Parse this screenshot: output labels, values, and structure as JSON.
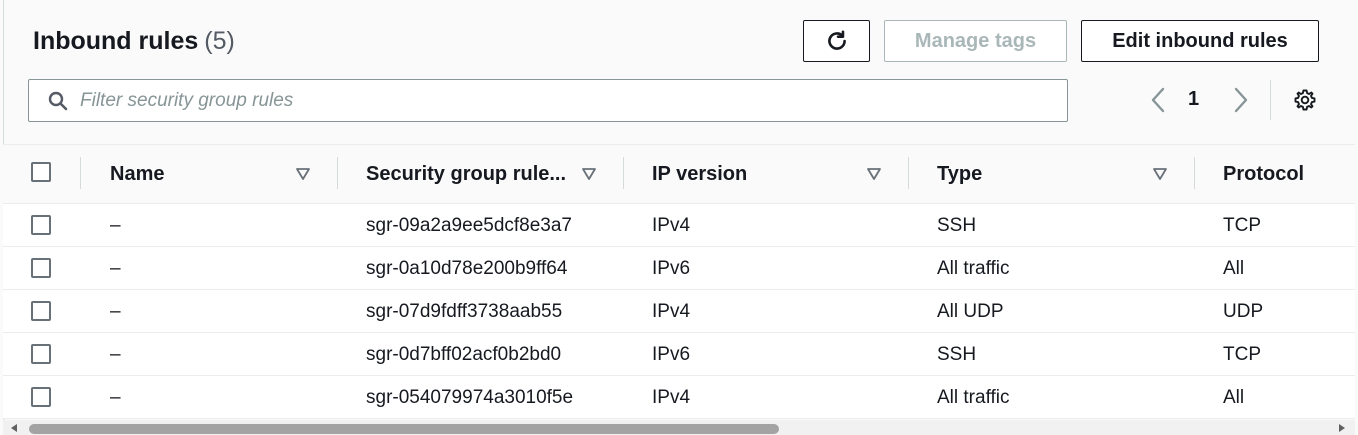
{
  "header": {
    "title": "Inbound rules",
    "count": "(5)",
    "manage_tags_label": "Manage tags",
    "edit_inbound_label": "Edit inbound rules"
  },
  "search": {
    "placeholder": "Filter security group rules",
    "value": ""
  },
  "pagination": {
    "current_page": "1"
  },
  "columns": [
    "Name",
    "Security group rule...",
    "IP version",
    "Type",
    "Protocol"
  ],
  "rows": [
    {
      "name": "–",
      "rule_id": "sgr-09a2a9ee5dcf8e3a7",
      "ip_version": "IPv4",
      "type": "SSH",
      "protocol": "TCP"
    },
    {
      "name": "–",
      "rule_id": "sgr-0a10d78e200b9ff64",
      "ip_version": "IPv6",
      "type": "All traffic",
      "protocol": "All"
    },
    {
      "name": "–",
      "rule_id": "sgr-07d9fdff3738aab55",
      "ip_version": "IPv4",
      "type": "All UDP",
      "protocol": "UDP"
    },
    {
      "name": "–",
      "rule_id": "sgr-0d7bff02acf0b2bd0",
      "ip_version": "IPv6",
      "type": "SSH",
      "protocol": "TCP"
    },
    {
      "name": "–",
      "rule_id": "sgr-054079974a3010f5e",
      "ip_version": "IPv4",
      "type": "All traffic",
      "protocol": "All"
    }
  ],
  "icons": {
    "refresh": "refresh-icon",
    "search": "search-icon",
    "prev": "chevron-left-icon",
    "next": "chevron-right-icon",
    "settings": "gear-icon",
    "sort": "sort-down-icon"
  },
  "colors": {
    "text": "#16191f",
    "disabled": "#aab7b8",
    "border": "#eaeded",
    "placeholder": "#879596"
  }
}
